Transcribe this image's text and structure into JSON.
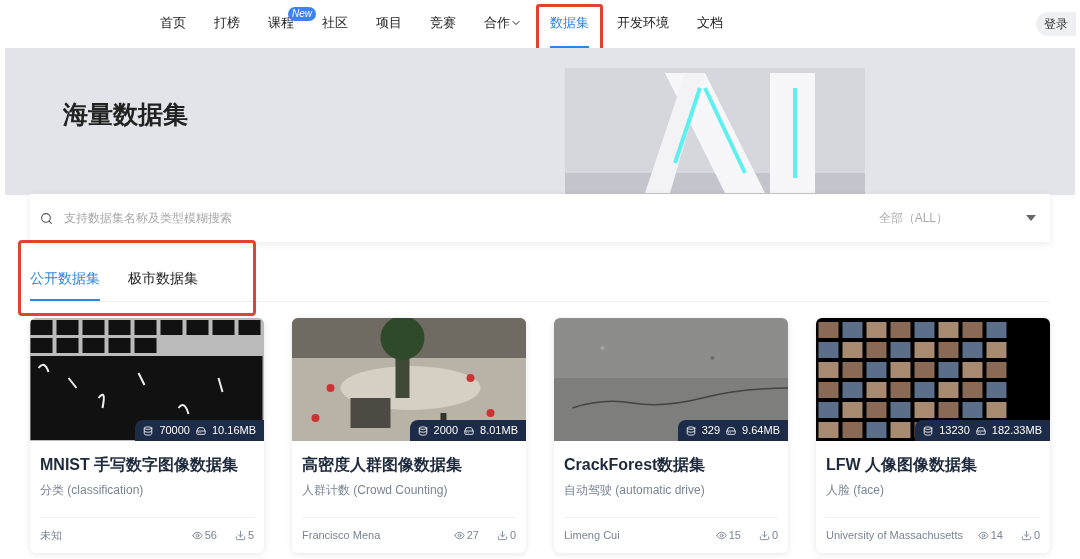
{
  "nav": {
    "items": [
      {
        "label": "首页",
        "selected": false
      },
      {
        "label": "打榜",
        "selected": false
      },
      {
        "label": "课程",
        "selected": false,
        "badge": "New"
      },
      {
        "label": "社区",
        "selected": false
      },
      {
        "label": "项目",
        "selected": false
      },
      {
        "label": "竞赛",
        "selected": false
      },
      {
        "label": "合作",
        "selected": false,
        "dropdown": true
      },
      {
        "label": "数据集",
        "selected": true,
        "highlighted": true
      },
      {
        "label": "开发环境",
        "selected": false
      },
      {
        "label": "文档",
        "selected": false
      }
    ],
    "login": "登录"
  },
  "banner": {
    "title": "海量数据集"
  },
  "search": {
    "placeholder": "支持数据集名称及类型模糊搜索",
    "filter": "全部（ALL）"
  },
  "tabs": {
    "highlighted": true,
    "items": [
      {
        "label": "公开数据集",
        "selected": true
      },
      {
        "label": "极市数据集",
        "selected": false
      }
    ]
  },
  "datasets": [
    {
      "count": "70000",
      "size": "10.16MB",
      "title": "MNIST 手写数字图像数据集",
      "category": "分类 (classification)",
      "author": "未知",
      "views": "56",
      "downloads": "5"
    },
    {
      "count": "2000",
      "size": "8.01MB",
      "title": "高密度人群图像数据集",
      "category": "人群计数 (Crowd Counting)",
      "author": "Francisco Mena",
      "views": "27",
      "downloads": "0"
    },
    {
      "count": "329",
      "size": "9.64MB",
      "title": "CrackForest数据集",
      "category": "自动驾驶 (automatic drive)",
      "author": "Limeng Cui",
      "views": "15",
      "downloads": "0"
    },
    {
      "count": "13230",
      "size": "182.33MB",
      "title": "LFW 人像图像数据集",
      "category": "人脸 (face)",
      "author": "University of Massachusetts",
      "views": "14",
      "downloads": "0"
    }
  ]
}
